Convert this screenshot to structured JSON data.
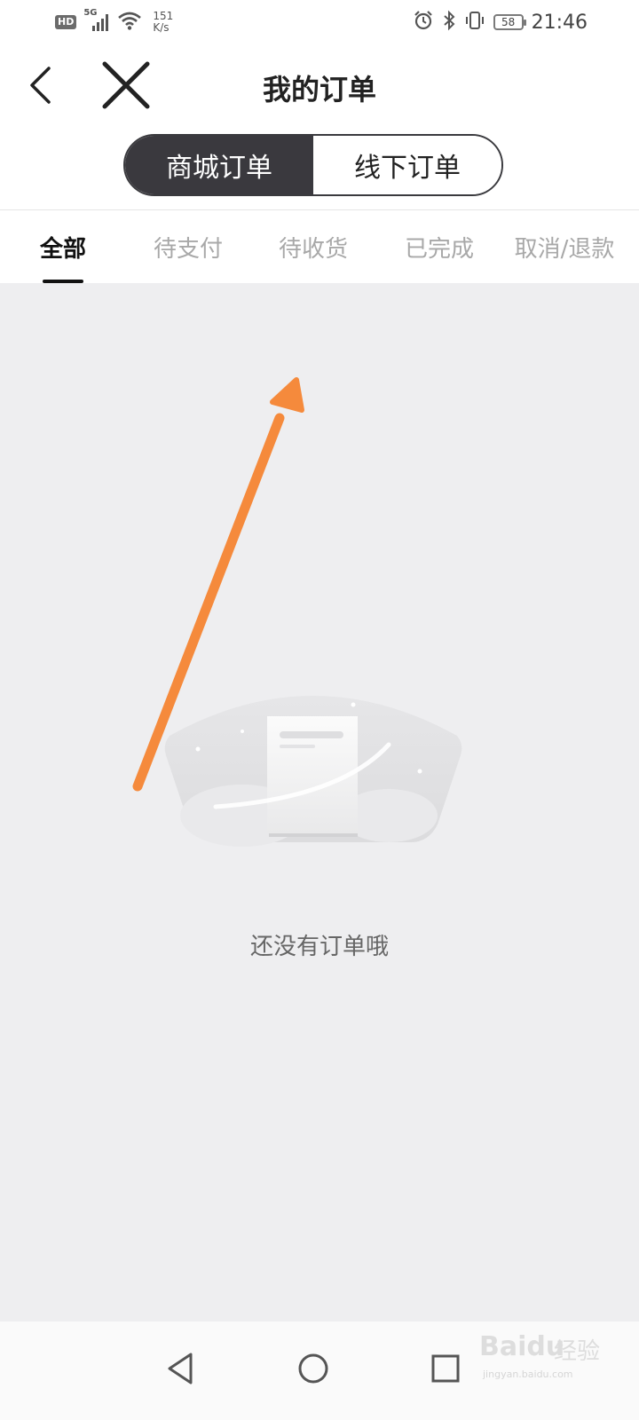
{
  "status_bar": {
    "network_badge": "HD",
    "network_type": "5G",
    "speed_value": "151",
    "speed_unit": "K/s",
    "battery_level": "58",
    "time": "21:46"
  },
  "navbar": {
    "title": "我的订单"
  },
  "segmented_control": {
    "options": [
      "商城订单",
      "线下订单"
    ],
    "selected": "商城订单"
  },
  "order_tabs": {
    "items": [
      "全部",
      "待支付",
      "待收货",
      "已完成",
      "取消/退款"
    ],
    "active": "全部"
  },
  "empty_state": {
    "message": "还没有订单哦"
  },
  "annotation": {
    "color": "#f58a3c"
  },
  "watermark": {
    "brand": "Bai",
    "brand_suffix": "du",
    "label": "经验",
    "url": "jingyan.baidu.com"
  },
  "theme": {
    "accent_dark": "#3a393e",
    "content_bg": "#eeeef0",
    "inactive_tab": "#a8a8a8"
  }
}
